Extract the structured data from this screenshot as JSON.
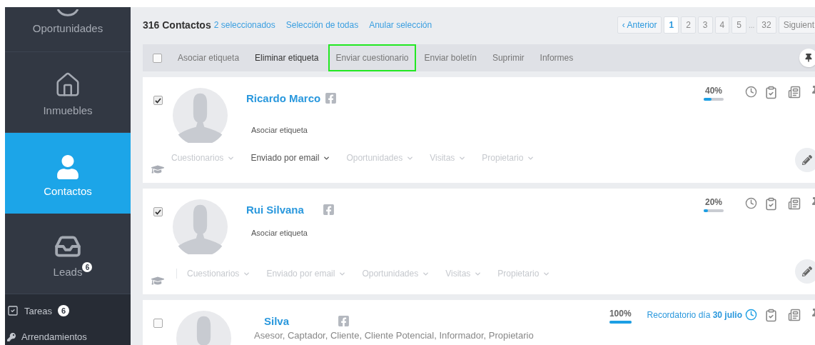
{
  "sidebar": {
    "items": [
      {
        "label": "Oportunidades",
        "kind": "partial",
        "selected": false
      },
      {
        "label": "Inmuebles",
        "kind": "house",
        "selected": false
      },
      {
        "label": "Contactos",
        "kind": "person",
        "selected": true
      },
      {
        "label": "Leads",
        "kind": "inbox",
        "selected": false,
        "badge": "6"
      }
    ],
    "links": [
      {
        "label": "Tareas",
        "kind": "tasks",
        "badge": "6"
      },
      {
        "label": "Arrendamientos",
        "kind": "key"
      }
    ]
  },
  "header": {
    "count": "316 Contactos",
    "selected_count": "2 seleccionados",
    "links": [
      "Selección de todas",
      "Anular selección"
    ]
  },
  "pagination": {
    "previous": "‹ Anterior",
    "pages": [
      {
        "label": "1",
        "selected": true
      },
      {
        "label": "2",
        "selected": false
      },
      {
        "label": "3",
        "selected": false
      },
      {
        "label": "4",
        "selected": false
      },
      {
        "label": "5",
        "selected": false
      }
    ],
    "ellipsis": "...",
    "last_page": {
      "label": "32",
      "selected": false
    },
    "next": "Siguient"
  },
  "toolbar": {
    "checked": false,
    "actions": [
      {
        "label": "Asociar etiqueta",
        "emphasis": false,
        "highlighted": false
      },
      {
        "label": "Eliminar etiqueta",
        "emphasis": true,
        "highlighted": false
      },
      {
        "label": "Enviar cuestionario",
        "emphasis": false,
        "highlighted": true
      },
      {
        "label": "Enviar boletín",
        "emphasis": false,
        "highlighted": false
      },
      {
        "label": "Suprimir",
        "emphasis": false,
        "highlighted": false
      },
      {
        "label": "Informes",
        "emphasis": false,
        "highlighted": false
      }
    ]
  },
  "contacts": [
    {
      "name": "Ricardo Marco",
      "checked": true,
      "tags": "Asociar etiqueta",
      "kind": "prompt",
      "progress": "40%",
      "level": 0.4,
      "filters": [
        {
          "label": "Cuestionarios",
          "active": false
        },
        {
          "label": "Enviado por email",
          "active": true
        },
        {
          "label": "Oportunidades",
          "active": false
        },
        {
          "label": "Visitas",
          "active": false
        },
        {
          "label": "Propietario",
          "active": false
        }
      ]
    },
    {
      "name": "Rui Silvana",
      "checked": true,
      "tags": "Asociar etiqueta",
      "kind": "prompt",
      "progress": "20%",
      "level": 0.2,
      "filters": [
        {
          "label": "Cuestionarios",
          "active": false
        },
        {
          "label": "Enviado por email",
          "active": false
        },
        {
          "label": "Oportunidades",
          "active": false
        },
        {
          "label": "Visitas",
          "active": false
        },
        {
          "label": "Propietario",
          "active": false
        }
      ]
    },
    {
      "name": "Silva",
      "checked": false,
      "tags": "Asesor, Captador, Cliente, Cliente Potencial, Informador, Propietario",
      "kind": "list",
      "progress": "100%",
      "level": 1,
      "reminder": "Recordatorio día **30 julio**"
    }
  ]
}
